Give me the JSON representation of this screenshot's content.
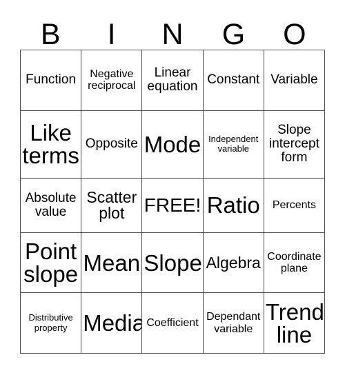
{
  "card": {
    "type": "bingo-card",
    "columns": 5,
    "rows": 5,
    "header_letters": [
      "B",
      "I",
      "N",
      "G",
      "O"
    ],
    "free_space_label": "FREE!",
    "free_space_position": {
      "row": 3,
      "column": 3
    },
    "border_color": "#4d4d4d",
    "background_color": "#ffffff",
    "text_color": "#000000",
    "grid": [
      [
        {
          "label": "Function",
          "size": "fs-md"
        },
        {
          "label": "Negative\nreciprocal",
          "size": "fs-sm"
        },
        {
          "label": "Linear\nequation",
          "size": "fs-md"
        },
        {
          "label": "Constant",
          "size": "fs-md"
        },
        {
          "label": "Variable",
          "size": "fs-md"
        }
      ],
      [
        {
          "label": "Like\nterms",
          "size": "fs-xxl"
        },
        {
          "label": "Opposite",
          "size": "fs-md"
        },
        {
          "label": "Mode",
          "size": "fs-xxl"
        },
        {
          "label": "Independent\nvariable",
          "size": "fs-xs"
        },
        {
          "label": "Slope\nintercept\nform",
          "size": "fs-md"
        }
      ],
      [
        {
          "label": "Absolute\nvalue",
          "size": "fs-md"
        },
        {
          "label": "Scatter\nplot",
          "size": "fs-lg"
        },
        {
          "label": "FREE!",
          "size": "fs-xl"
        },
        {
          "label": "Ratio",
          "size": "fs-xxl"
        },
        {
          "label": "Percents",
          "size": "fs-sm"
        }
      ],
      [
        {
          "label": "Point\nslope",
          "size": "fs-xxl"
        },
        {
          "label": "Mean",
          "size": "fs-xxl"
        },
        {
          "label": "Slope",
          "size": "fs-xxl"
        },
        {
          "label": "Algebra",
          "size": "fs-lg"
        },
        {
          "label": "Coordinate\nplane",
          "size": "fs-sm"
        }
      ],
      [
        {
          "label": "Distributive\nproperty",
          "size": "fs-xs"
        },
        {
          "label": "Median",
          "size": "fs-xxl"
        },
        {
          "label": "Coefficient",
          "size": "fs-sm"
        },
        {
          "label": "Dependant\nvariable",
          "size": "fs-sm"
        },
        {
          "label": "Trend\nline",
          "size": "fs-xxl"
        }
      ]
    ]
  }
}
